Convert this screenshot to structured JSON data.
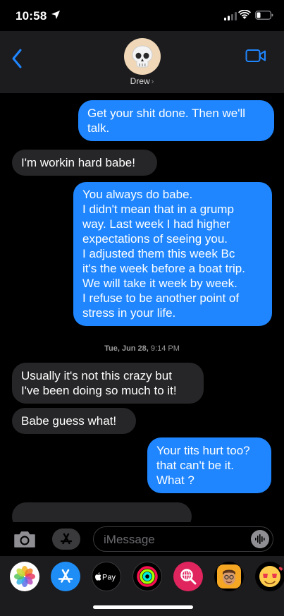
{
  "status": {
    "time": "10:58"
  },
  "header": {
    "contact_name": "Drew",
    "avatar_emoji": "💀"
  },
  "messages": [
    {
      "dir": "out",
      "lines": [
        "Get your shit done. Then we'll",
        "talk."
      ]
    },
    {
      "dir": "in",
      "lines": [
        "I'm workin hard babe!"
      ]
    },
    {
      "dir": "out",
      "lines": [
        "You always do babe.",
        "I didn't mean that in a grump",
        "way. Last week I had higher",
        "expectations of seeing you.",
        "I adjusted them this week Bc",
        "it's the week before a boat trip.",
        "We will  take it week by week.",
        "I refuse to be another point of",
        "stress in your life."
      ]
    },
    {
      "dir": "in",
      "lines": [
        "Usually it's not this crazy but",
        "I've been doing so much to it!"
      ]
    },
    {
      "dir": "in",
      "lines": [
        "Babe guess what!"
      ]
    },
    {
      "dir": "out",
      "lines": [
        "Your tits hurt too?",
        "that can't be it.",
        "What ?"
      ]
    },
    {
      "dir": "in",
      "lines": []
    }
  ],
  "timestamp": {
    "day": "Tue, Jun 28,",
    "time": "9:14 PM"
  },
  "input": {
    "placeholder": "iMessage"
  },
  "drawer": {
    "apple_pay_label": "Pay",
    "apps": [
      "photos-icon",
      "app-store-icon",
      "apple-pay-icon",
      "activity-icon",
      "web-search-icon",
      "memoji-icon",
      "animoji-icon"
    ]
  },
  "colors": {
    "outgoing": "#1f86ff",
    "incoming": "#262628",
    "background": "#000000",
    "header": "#1c1c1e"
  }
}
